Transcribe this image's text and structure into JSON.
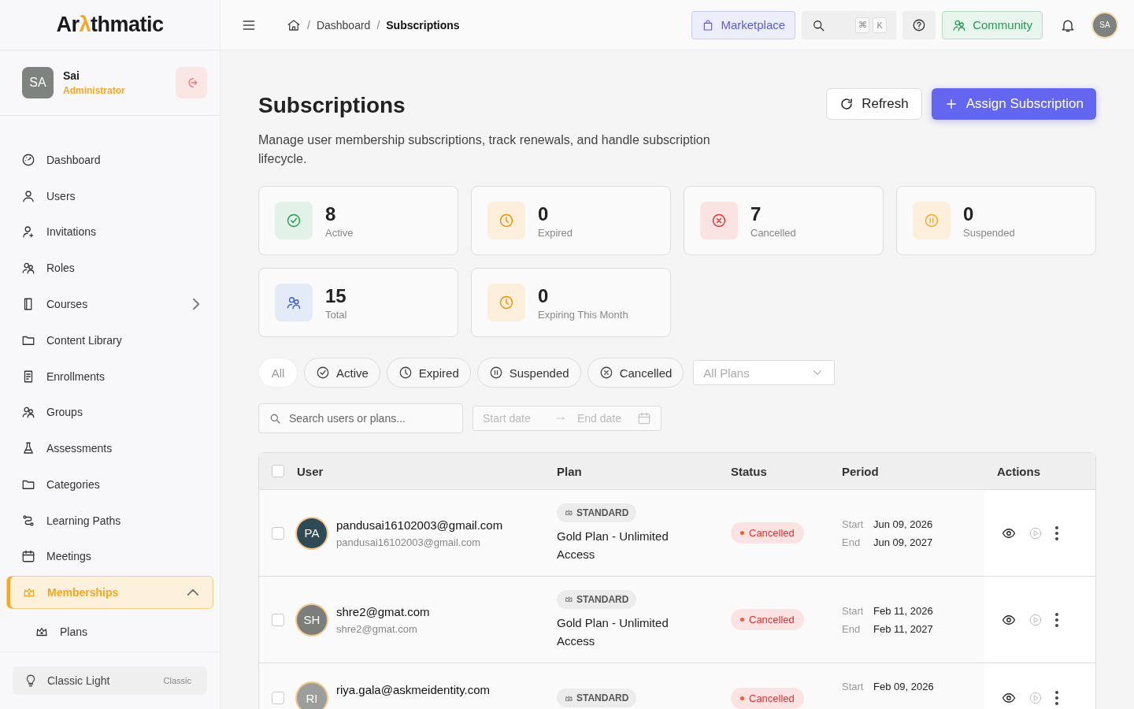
{
  "sidebar": {
    "logo": "Arλthmatic",
    "user": {
      "initials": "SA",
      "name": "Sai",
      "role": "Administrator"
    },
    "items": [
      {
        "label": "Dashboard",
        "selected": false
      },
      {
        "label": "Users",
        "selected": false
      },
      {
        "label": "Invitations",
        "selected": false
      },
      {
        "label": "Roles",
        "selected": false
      },
      {
        "label": "Courses",
        "selected": false,
        "expandable": true,
        "expanded": false
      },
      {
        "label": "Content Library",
        "selected": false
      },
      {
        "label": "Enrollments",
        "selected": false
      },
      {
        "label": "Groups",
        "selected": false
      },
      {
        "label": "Assessments",
        "selected": false
      },
      {
        "label": "Categories",
        "selected": false
      },
      {
        "label": "Learning Paths",
        "selected": false
      },
      {
        "label": "Meetings",
        "selected": false
      },
      {
        "label": "Memberships",
        "selected": true,
        "expandable": true,
        "expanded": true,
        "children": [
          {
            "label": "Plans",
            "selected": false
          }
        ]
      }
    ],
    "theme": {
      "label": "Classic Light",
      "badge": "Classic"
    }
  },
  "topbar": {
    "separator": "/",
    "breadcrumb": [
      "Dashboard",
      "Subscriptions"
    ],
    "marketplace": "Marketplace",
    "keys": [
      "⌘",
      "K"
    ],
    "community": "Community",
    "avatar": "SA"
  },
  "page": {
    "title": "Subscriptions",
    "description": "Manage user membership subscriptions, track renewals, and handle subscription lifecycle.",
    "refresh": "Refresh",
    "assign": "Assign Subscription"
  },
  "stats": [
    {
      "kind": "active",
      "value": "8",
      "label": "Active"
    },
    {
      "kind": "expired",
      "value": "0",
      "label": "Expired"
    },
    {
      "kind": "cancelled",
      "value": "7",
      "label": "Cancelled"
    },
    {
      "kind": "suspended",
      "value": "0",
      "label": "Suspended"
    },
    {
      "kind": "total",
      "value": "15",
      "label": "Total"
    },
    {
      "kind": "expiring",
      "value": "0",
      "label": "Expiring This Month"
    }
  ],
  "filters": [
    {
      "kind": "all",
      "label": "All",
      "selected": true
    },
    {
      "kind": "active",
      "label": "Active",
      "selected": false
    },
    {
      "kind": "expired",
      "label": "Expired",
      "selected": false
    },
    {
      "kind": "suspended",
      "label": "Suspended",
      "selected": false
    },
    {
      "kind": "cancelled",
      "label": "Cancelled",
      "selected": false
    }
  ],
  "plan_select": {
    "placeholder": "All Plans"
  },
  "search": {
    "placeholder": "Search users or plans..."
  },
  "date_range": {
    "start_placeholder": "Start date",
    "end_placeholder": "End date"
  },
  "table": {
    "select_all": {
      "checked": false
    },
    "columns": [
      "User",
      "Plan",
      "Status",
      "Period",
      "Actions"
    ],
    "rows": [
      {
        "checked": false,
        "initials": "PA",
        "color": "#2f4a55",
        "email": "pandusai16102003@gmail.com",
        "sub_email": "pandusai16102003@gmail.com",
        "tier": "STANDARD",
        "plan": "Gold Plan - Unlimited Access",
        "status": "Cancelled",
        "start_label": "Start",
        "start": "Jun 09, 2026",
        "end_label": "End",
        "end": "Jun 09, 2027"
      },
      {
        "checked": false,
        "initials": "SH",
        "color": "#7b7e7b",
        "email": "shre2@gmat.com",
        "sub_email": "shre2@gmat.com",
        "tier": "STANDARD",
        "plan": "Gold Plan - Unlimited Access",
        "status": "Cancelled",
        "start_label": "Start",
        "start": "Feb 11, 2026",
        "end_label": "End",
        "end": "Feb 11, 2027"
      },
      {
        "checked": false,
        "initials": "RI",
        "color": "#9c9e9b",
        "email": "riya.gala@askmeidentity.com",
        "tier": "STANDARD",
        "status": "Cancelled",
        "start_label": "Start",
        "start": "Feb 09, 2026"
      }
    ]
  }
}
